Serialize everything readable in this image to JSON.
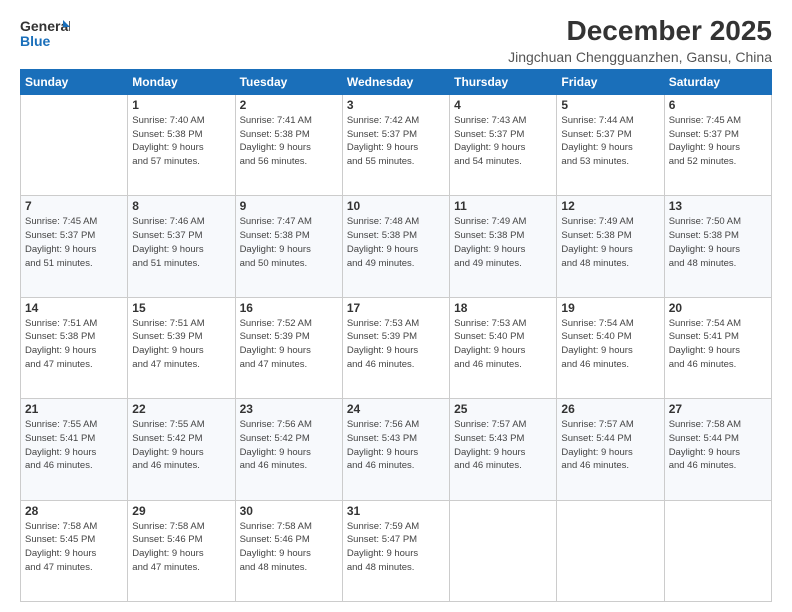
{
  "logo": {
    "line1": "General",
    "line2": "Blue"
  },
  "title": "December 2025",
  "location": "Jingchuan Chengguanzhen, Gansu, China",
  "header_days": [
    "Sunday",
    "Monday",
    "Tuesday",
    "Wednesday",
    "Thursday",
    "Friday",
    "Saturday"
  ],
  "weeks": [
    [
      {
        "day": "",
        "info": ""
      },
      {
        "day": "1",
        "info": "Sunrise: 7:40 AM\nSunset: 5:38 PM\nDaylight: 9 hours\nand 57 minutes."
      },
      {
        "day": "2",
        "info": "Sunrise: 7:41 AM\nSunset: 5:38 PM\nDaylight: 9 hours\nand 56 minutes."
      },
      {
        "day": "3",
        "info": "Sunrise: 7:42 AM\nSunset: 5:37 PM\nDaylight: 9 hours\nand 55 minutes."
      },
      {
        "day": "4",
        "info": "Sunrise: 7:43 AM\nSunset: 5:37 PM\nDaylight: 9 hours\nand 54 minutes."
      },
      {
        "day": "5",
        "info": "Sunrise: 7:44 AM\nSunset: 5:37 PM\nDaylight: 9 hours\nand 53 minutes."
      },
      {
        "day": "6",
        "info": "Sunrise: 7:45 AM\nSunset: 5:37 PM\nDaylight: 9 hours\nand 52 minutes."
      }
    ],
    [
      {
        "day": "7",
        "info": "Sunrise: 7:45 AM\nSunset: 5:37 PM\nDaylight: 9 hours\nand 51 minutes."
      },
      {
        "day": "8",
        "info": "Sunrise: 7:46 AM\nSunset: 5:37 PM\nDaylight: 9 hours\nand 51 minutes."
      },
      {
        "day": "9",
        "info": "Sunrise: 7:47 AM\nSunset: 5:38 PM\nDaylight: 9 hours\nand 50 minutes."
      },
      {
        "day": "10",
        "info": "Sunrise: 7:48 AM\nSunset: 5:38 PM\nDaylight: 9 hours\nand 49 minutes."
      },
      {
        "day": "11",
        "info": "Sunrise: 7:49 AM\nSunset: 5:38 PM\nDaylight: 9 hours\nand 49 minutes."
      },
      {
        "day": "12",
        "info": "Sunrise: 7:49 AM\nSunset: 5:38 PM\nDaylight: 9 hours\nand 48 minutes."
      },
      {
        "day": "13",
        "info": "Sunrise: 7:50 AM\nSunset: 5:38 PM\nDaylight: 9 hours\nand 48 minutes."
      }
    ],
    [
      {
        "day": "14",
        "info": "Sunrise: 7:51 AM\nSunset: 5:38 PM\nDaylight: 9 hours\nand 47 minutes."
      },
      {
        "day": "15",
        "info": "Sunrise: 7:51 AM\nSunset: 5:39 PM\nDaylight: 9 hours\nand 47 minutes."
      },
      {
        "day": "16",
        "info": "Sunrise: 7:52 AM\nSunset: 5:39 PM\nDaylight: 9 hours\nand 47 minutes."
      },
      {
        "day": "17",
        "info": "Sunrise: 7:53 AM\nSunset: 5:39 PM\nDaylight: 9 hours\nand 46 minutes."
      },
      {
        "day": "18",
        "info": "Sunrise: 7:53 AM\nSunset: 5:40 PM\nDaylight: 9 hours\nand 46 minutes."
      },
      {
        "day": "19",
        "info": "Sunrise: 7:54 AM\nSunset: 5:40 PM\nDaylight: 9 hours\nand 46 minutes."
      },
      {
        "day": "20",
        "info": "Sunrise: 7:54 AM\nSunset: 5:41 PM\nDaylight: 9 hours\nand 46 minutes."
      }
    ],
    [
      {
        "day": "21",
        "info": "Sunrise: 7:55 AM\nSunset: 5:41 PM\nDaylight: 9 hours\nand 46 minutes."
      },
      {
        "day": "22",
        "info": "Sunrise: 7:55 AM\nSunset: 5:42 PM\nDaylight: 9 hours\nand 46 minutes."
      },
      {
        "day": "23",
        "info": "Sunrise: 7:56 AM\nSunset: 5:42 PM\nDaylight: 9 hours\nand 46 minutes."
      },
      {
        "day": "24",
        "info": "Sunrise: 7:56 AM\nSunset: 5:43 PM\nDaylight: 9 hours\nand 46 minutes."
      },
      {
        "day": "25",
        "info": "Sunrise: 7:57 AM\nSunset: 5:43 PM\nDaylight: 9 hours\nand 46 minutes."
      },
      {
        "day": "26",
        "info": "Sunrise: 7:57 AM\nSunset: 5:44 PM\nDaylight: 9 hours\nand 46 minutes."
      },
      {
        "day": "27",
        "info": "Sunrise: 7:58 AM\nSunset: 5:44 PM\nDaylight: 9 hours\nand 46 minutes."
      }
    ],
    [
      {
        "day": "28",
        "info": "Sunrise: 7:58 AM\nSunset: 5:45 PM\nDaylight: 9 hours\nand 47 minutes."
      },
      {
        "day": "29",
        "info": "Sunrise: 7:58 AM\nSunset: 5:46 PM\nDaylight: 9 hours\nand 47 minutes."
      },
      {
        "day": "30",
        "info": "Sunrise: 7:58 AM\nSunset: 5:46 PM\nDaylight: 9 hours\nand 48 minutes."
      },
      {
        "day": "31",
        "info": "Sunrise: 7:59 AM\nSunset: 5:47 PM\nDaylight: 9 hours\nand 48 minutes."
      },
      {
        "day": "",
        "info": ""
      },
      {
        "day": "",
        "info": ""
      },
      {
        "day": "",
        "info": ""
      }
    ]
  ]
}
